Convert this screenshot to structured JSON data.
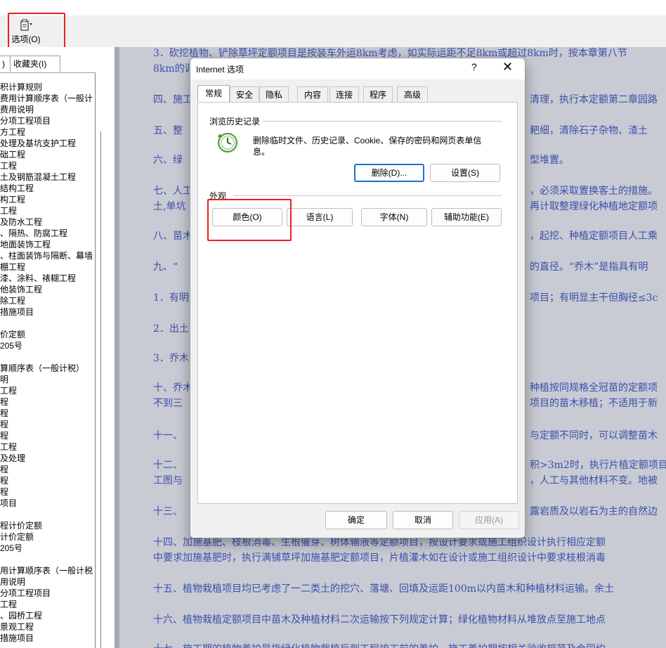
{
  "toolbar": {
    "options_label": "选项(O)"
  },
  "left_pane": {
    "tabs": [
      ")",
      "收藏夹(I)"
    ],
    "tree": [
      "积计算规则",
      "费用计算顺序表（一般计",
      "费用说明",
      "分项工程项目",
      "方工程",
      "处理及基坑支护工程",
      "础工程",
      "工程",
      "土及钢筋混凝土工程",
      "结构工程",
      "构工程",
      "工程",
      "及防水工程",
      "、隔热、防腐工程",
      "地面装饰工程",
      "、柱面装饰与隔断、幕墙",
      "棚工程",
      "漆、涂料、裱糊工程",
      "他装饰工程",
      "除工程",
      "措施项目",
      "",
      "价定额",
      "205号",
      "",
      "算顺序表（一般计税）",
      "明",
      "工程",
      "程",
      "程",
      "程",
      "程",
      "工程",
      "及处理",
      "程",
      "程",
      "程",
      "项目",
      "",
      "程计价定额",
      "计价定额",
      "205号",
      "",
      "用计算顺序表（一般计税",
      "用说明",
      "分项工程项目",
      "工程",
      "、园桥工程",
      "景观工程",
      "措施项目"
    ]
  },
  "document": {
    "lines": [
      "3．砍挖植物、铲除草坪定额项目是按装车外运8km考虑，如实际运距不足8km或超过8km时，按本章第八节",
      "8km的调",
      "四、施工",
      "清理，执行本定额第二章园路",
      "五、整",
      "耙细，清除石子杂物、渣土",
      "六、绿",
      "型堆置。",
      "七、人工",
      "，必须采取置换客土的措施。",
      "土,单坑",
      "再计取整理绿化种植地定额项",
      "八、苗木",
      "，起挖、种植定额项目人工乘",
      "九、“",
      "的直径。“乔木”是指具有明",
      "1．有明",
      "项目；有明显主干但胸径≤3c",
      "2．出土",
      "3．乔木",
      "十、乔木",
      "种植按同规格全冠苗的定额项",
      "不到三",
      "项目的苗木移植；不适用于新",
      "十一、",
      "与定额不同时，可以调整苗木",
      "十二、",
      "积>3m2时，执行片植定额项目",
      "工图与",
      "，人工与其他材料不变。地被",
      "十三、",
      "露岩质及以岩石为主的自然边",
      "十四、加施基肥、枝根消毒、生根催芽、树体输液等定额项目，按设计要求或施工组织设计执行相应定额",
      "中要求加施基肥时，执行满铺草坪加施基肥定额项目，片植灌木如在设计或施工组织设计中要求枝根消毒",
      "十五、植物栽植项目均已考虑了一二类土的挖穴、落塘、回填及运距100m以内苗木和种植材料运输。余土",
      "十六、植物栽植定额项目中苗木及种植材料二次运输按下列规定计算；绿化植物材料从堆放点至施工地点",
      "十七、施工期的植物养护是指绿化植物栽植后到工程竣工前的养护，施工养护期按相关验收规范及合同约"
    ]
  },
  "dialog": {
    "title": "Internet 选项",
    "help": "?",
    "close": "✕",
    "tabs": [
      "常规",
      "安全",
      "隐私",
      "内容",
      "连接",
      "程序",
      "高级"
    ],
    "history": {
      "group_title": "浏览历史记录",
      "description": "删除临时文件、历史记录、Cookie、保存的密码和网页表单信息。",
      "delete_button": "删除(D)...",
      "settings_button": "设置(S)"
    },
    "appearance": {
      "group_title": "外观",
      "colors_button": "颜色(O)",
      "languages_button": "语言(L)",
      "fonts_button": "字体(N)",
      "accessibility_button": "辅助功能(E)"
    },
    "footer": {
      "ok": "确定",
      "cancel": "取消",
      "apply": "应用(A)"
    }
  },
  "colors": {
    "highlight": "#e8201e",
    "doc_text": "#3c50a8",
    "doc_bg": "#c8cad4",
    "focus": "#1e6fd0"
  }
}
